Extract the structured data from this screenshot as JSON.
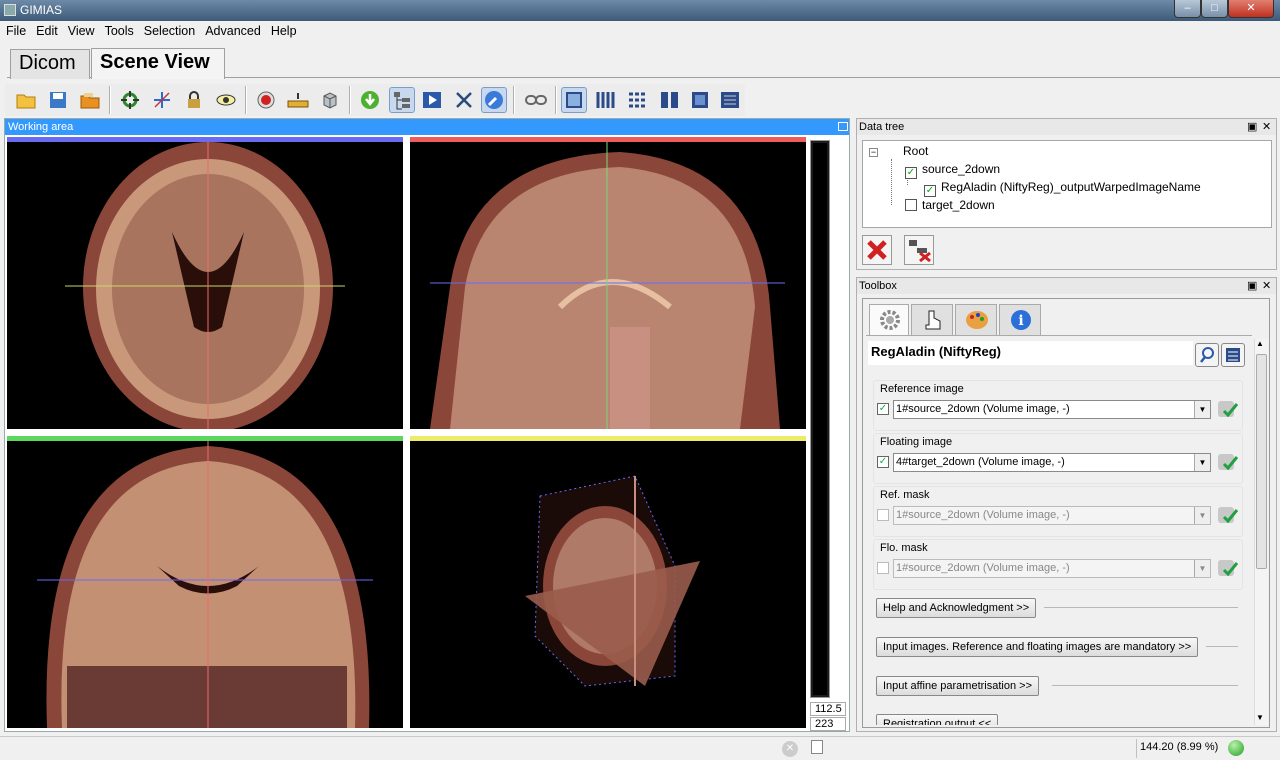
{
  "window": {
    "title": "GIMIAS",
    "minimize": "‒",
    "maximize": "□",
    "close": "✕"
  },
  "menu": [
    "File",
    "Edit",
    "View",
    "Tools",
    "Selection",
    "Advanced",
    "Help"
  ],
  "tabs": [
    {
      "label": "Dicom",
      "active": false
    },
    {
      "label": "Scene View",
      "active": true
    }
  ],
  "toolbar": {
    "items": [
      "open-folder-icon",
      "save-icon",
      "open-files-icon",
      "reset-view-icon",
      "crosshair-icon",
      "lock-icon",
      "eye-icon",
      "record-icon",
      "ruler-icon",
      "cube-icon",
      "download-icon",
      "tree-icon",
      "play-icon",
      "tools-icon",
      "wrench-icon",
      "link-icon",
      "layout-single-icon",
      "layout-columns-icon",
      "layout-grid-icon",
      "layout-two-icon",
      "layout-square-icon",
      "layout-custom-icon"
    ]
  },
  "working_area": {
    "title": "Working area",
    "slider_value": "112.5",
    "slice_value": "223",
    "view_colors": {
      "axial": "#6a6af2",
      "sagittal": "#ef5a5a",
      "coronal": "#5cd85c",
      "3d": "#ecec6a"
    }
  },
  "data_tree": {
    "title": "Data tree",
    "root": "Root",
    "items": [
      {
        "label": "source_2down",
        "checked": true
      },
      {
        "label": "RegAladin (NiftyReg)_outputWarpedImageName",
        "checked": true
      },
      {
        "label": "target_2down",
        "checked": false
      }
    ]
  },
  "toolbox": {
    "title": "Toolbox",
    "tabs": [
      "gear-icon",
      "hand-pointer-icon",
      "palette-icon",
      "info-icon"
    ],
    "tool_title": "RegAladin (NiftyReg)",
    "fields": [
      {
        "label": "Reference image",
        "value": "1#source_2down (Volume image, -)",
        "checked": true,
        "enabled": true
      },
      {
        "label": "Floating image",
        "value": "4#target_2down (Volume image, -)",
        "checked": true,
        "enabled": true
      },
      {
        "label": "Ref. mask",
        "value": "1#source_2down (Volume image, -)",
        "checked": false,
        "enabled": false
      },
      {
        "label": "Flo. mask",
        "value": "1#source_2down (Volume image, -)",
        "checked": false,
        "enabled": false
      }
    ],
    "sections": [
      "Help and Acknowledgment >>",
      "Input images. Reference and floating images are mandatory >>",
      "Input affine parametrisation >>",
      "Registration output <<"
    ]
  },
  "status": {
    "memory": "144.20  (8.99 %)"
  }
}
